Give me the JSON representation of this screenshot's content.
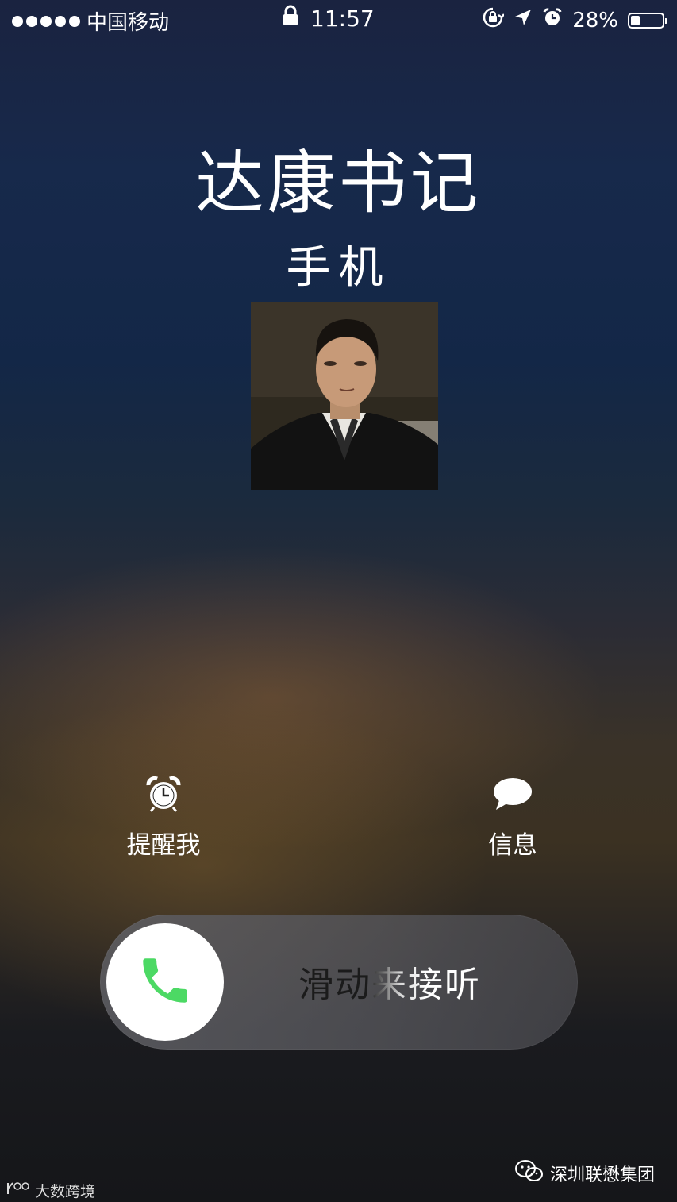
{
  "status_bar": {
    "carrier": "中国移动",
    "time": "11:57",
    "battery_percent": "28%",
    "battery_level": 0.28,
    "icons": [
      "signal-dots-icon",
      "lock-icon",
      "rotation-lock-icon",
      "location-arrow-icon",
      "alarm-icon",
      "battery-icon"
    ]
  },
  "call": {
    "caller_name": "达康书记",
    "caller_subtitle": "手机"
  },
  "actions": {
    "remind_label": "提醒我",
    "message_label": "信息"
  },
  "slider": {
    "label": "滑动来接听",
    "accent": "#4cd964"
  },
  "watermarks": {
    "left": "大数跨境",
    "right": "深圳联懋集团"
  }
}
